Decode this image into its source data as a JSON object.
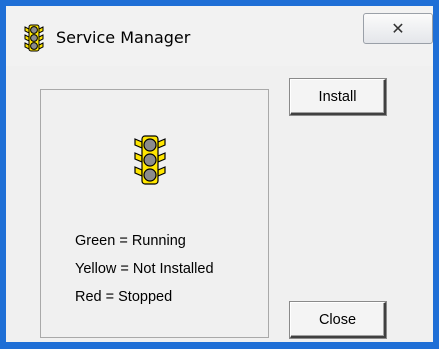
{
  "window": {
    "title": "Service Manager",
    "title_icon": "traffic-light-icon",
    "close_glyph": "✕"
  },
  "panel": {
    "status_icon": "traffic-light-icon",
    "legend": [
      "Green = Running",
      "Yellow = Not Installed",
      "Red = Stopped"
    ]
  },
  "buttons": {
    "install_label": "Install",
    "close_label": "Close"
  },
  "colors": {
    "frame_border": "#1f6fd6",
    "traffic_light_body": "#ffe600",
    "traffic_light_lamp": "#8c8c8c"
  }
}
